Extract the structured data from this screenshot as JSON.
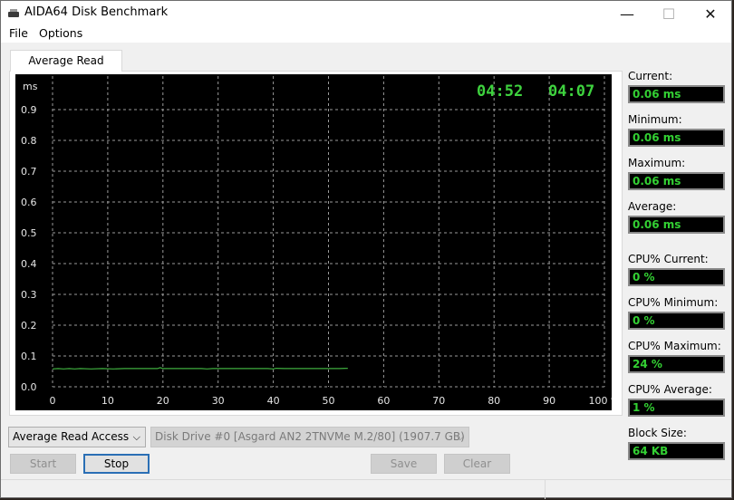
{
  "window": {
    "title": "AIDA64 Disk Benchmark",
    "controls": {
      "minimize": "—",
      "maximize": "☐",
      "close": "✕"
    }
  },
  "menu": [
    "File",
    "Options"
  ],
  "tab": {
    "label": "Average Read Access"
  },
  "clocks": {
    "elapsed": "04:52",
    "remaining": "04:07"
  },
  "stats": [
    {
      "label": "Current:",
      "value": "0.06 ms"
    },
    {
      "label": "Minimum:",
      "value": "0.06 ms"
    },
    {
      "label": "Maximum:",
      "value": "0.06 ms"
    },
    {
      "label": "Average:",
      "value": "0.06 ms"
    },
    {
      "label": "CPU% Current:",
      "value": "0 %"
    },
    {
      "label": "CPU% Minimum:",
      "value": "0 %"
    },
    {
      "label": "CPU% Maximum:",
      "value": "24 %"
    },
    {
      "label": "CPU% Average:",
      "value": "1 %"
    },
    {
      "label": "Block Size:",
      "value": "64 KB"
    }
  ],
  "controls": {
    "test_select": "Average Read Access",
    "drive_select": "Disk Drive #0  [Asgard AN2 2TNVMe M.2/80]  (1907.7 GB)",
    "start": "Start",
    "stop": "Stop",
    "save": "Save",
    "clear": "Clear",
    "dropdown_arrow": "⌵"
  },
  "colors": {
    "line": "#3fae3f",
    "digits": "#33d033",
    "focus_border": "#2a6fb5"
  },
  "chart_data": {
    "type": "line",
    "title": "Average Read Access",
    "ylabel": "ms",
    "xlabel": "%",
    "ylim": [
      0,
      0.9
    ],
    "xlim": [
      0,
      100
    ],
    "yticks": [
      "0.0",
      "0.1",
      "0.2",
      "0.3",
      "0.4",
      "0.5",
      "0.6",
      "0.7",
      "0.8",
      "0.9"
    ],
    "xticks": [
      "0",
      "10",
      "20",
      "30",
      "40",
      "50",
      "60",
      "70",
      "80",
      "90",
      "100 %"
    ],
    "grid": true,
    "series": [
      {
        "name": "Average Read Access",
        "x": [
          0,
          1,
          2,
          3,
          4,
          5,
          7,
          9,
          11,
          13,
          15,
          17,
          19,
          19.5,
          20,
          21,
          23,
          25,
          27,
          28,
          29,
          31,
          33,
          35,
          37,
          39,
          40,
          40.5,
          42,
          44,
          46,
          48,
          50,
          52,
          53.5
        ],
        "y": [
          0.058,
          0.059,
          0.058,
          0.059,
          0.058,
          0.059,
          0.058,
          0.059,
          0.058,
          0.059,
          0.059,
          0.059,
          0.059,
          0.062,
          0.059,
          0.059,
          0.059,
          0.059,
          0.059,
          0.058,
          0.059,
          0.059,
          0.059,
          0.059,
          0.059,
          0.059,
          0.058,
          0.06,
          0.059,
          0.059,
          0.059,
          0.059,
          0.059,
          0.059,
          0.06
        ]
      }
    ]
  }
}
